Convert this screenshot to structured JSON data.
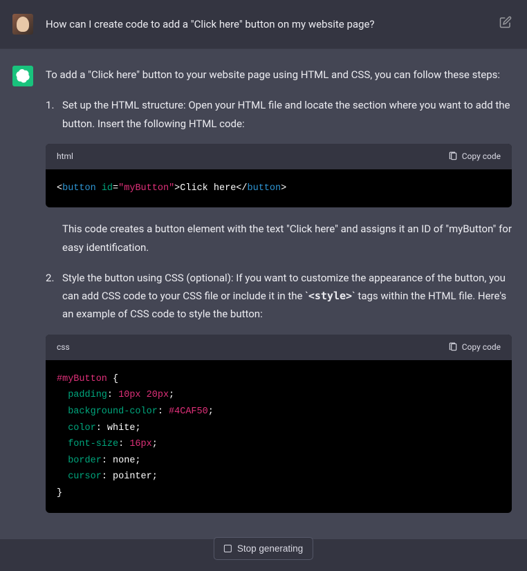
{
  "user": {
    "question": "How can I create code to add a \"Click here\" button on my website page?"
  },
  "assistant": {
    "intro": "To add a \"Click here\" button to your website page using HTML and CSS, you can follow these steps:",
    "step1_text": "Set up the HTML structure: Open your HTML file and locate the section where you want to add the button. Insert the following HTML code:",
    "code1": {
      "lang": "html",
      "tokens": {
        "open_lt": "<",
        "tag": "button",
        "sp": " ",
        "attr": "id",
        "eq": "=",
        "q1": "\"",
        "val": "myButton",
        "q2": "\"",
        "gt": ">",
        "inner": "Click here",
        "close": "</",
        "tag2": "button",
        "gt2": ">"
      }
    },
    "after_code1": "This code creates a button element with the text \"Click here\" and assigns it an ID of \"myButton\" for easy identification.",
    "step2_pre": "Style the button using CSS (optional): If you want to customize the appearance of the button, you can add CSS code to your CSS file or include it in the ",
    "step2_tick1": "`",
    "step2_code": "<style>",
    "step2_tick2": "`",
    "step2_post": " tags within the HTML file. Here's an example of CSS code to style the button:",
    "code2": {
      "lang": "css",
      "sel": "#myButton",
      "brace_open": " {",
      "l1_prop": "padding",
      "l1_colon": ": ",
      "l1_val1": "10px",
      "l1_sp": " ",
      "l1_val2": "20px",
      "l1_semi": ";",
      "l2_prop": "background-color",
      "l2_colon": ": ",
      "l2_val": "#4CAF50",
      "l2_semi": ";",
      "l3_prop": "color",
      "l3_colon": ": ",
      "l3_val": "white",
      "l3_semi": ";",
      "l4_prop": "font-size",
      "l4_colon": ": ",
      "l4_val": "16px",
      "l4_semi": ";",
      "l5_prop": "border",
      "l5_colon": ": ",
      "l5_val": "none",
      "l5_semi": ";",
      "l6_prop": "cursor",
      "l6_colon": ": ",
      "l6_val": "pointer",
      "l6_semi": ";",
      "brace_close": "}"
    }
  },
  "ui": {
    "copy_label": "Copy code",
    "stop_label": "Stop generating"
  }
}
